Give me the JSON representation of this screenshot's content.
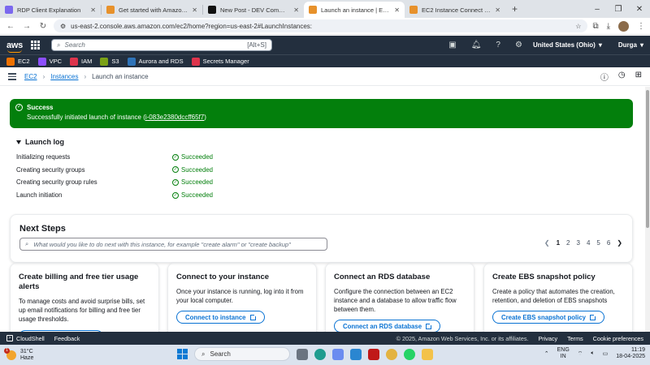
{
  "browser": {
    "tabs": [
      {
        "title": "RDP Client Explanation",
        "favicon_color": "#7b68ee",
        "active": false
      },
      {
        "title": "Get started with Amazon EC2",
        "favicon_color": "#e7912b",
        "active": false
      },
      {
        "title": "New Post - DEV Community",
        "favicon_color": "#111111",
        "active": false
      },
      {
        "title": "Launch an instance | EC2 | us-e",
        "favicon_color": "#e7912b",
        "active": true
      },
      {
        "title": "EC2 Instance Connect | us-east",
        "favicon_color": "#e7912b",
        "active": false
      }
    ],
    "url": "us-east-2.console.aws.amazon.com/ec2/home?region=us-east-2#LaunchInstances:"
  },
  "aws": {
    "logo": "aws",
    "search_placeholder": "Search",
    "search_shortcut": "[Alt+S]",
    "region": "United States (Ohio)",
    "user": "Durga",
    "favorites": [
      {
        "label": "EC2",
        "color": "#ed7100"
      },
      {
        "label": "VPC",
        "color": "#8c4fff"
      },
      {
        "label": "IAM",
        "color": "#dd344c"
      },
      {
        "label": "S3",
        "color": "#7aa116"
      },
      {
        "label": "Aurora and RDS",
        "color": "#2e73b8"
      },
      {
        "label": "Secrets Manager",
        "color": "#dd344c"
      }
    ]
  },
  "breadcrumb": {
    "ec2": "EC2",
    "instances": "Instances",
    "current": "Launch an instance"
  },
  "flash": {
    "title": "Success",
    "message_prefix": "Successfully initiated launch of instance (",
    "instance_id": "i-083e2380dccff65f7",
    "message_suffix": ")"
  },
  "launch_log": {
    "title": "Launch log",
    "rows": [
      {
        "step": "Initializing requests",
        "status": "Succeeded"
      },
      {
        "step": "Creating security groups",
        "status": "Succeeded"
      },
      {
        "step": "Creating security group rules",
        "status": "Succeeded"
      },
      {
        "step": "Launch initiation",
        "status": "Succeeded"
      }
    ]
  },
  "next_steps": {
    "title": "Next Steps",
    "search_placeholder": "What would you like to do next with this instance, for example \"create alarm\" or \"create backup\"",
    "pages": [
      "1",
      "2",
      "3",
      "4",
      "5",
      "6"
    ],
    "current_page": "1"
  },
  "cards": [
    {
      "title": "Create billing and free tier usage alerts",
      "desc": "To manage costs and avoid surprise bills, set up email notifications for billing and free tier usage thresholds.",
      "button": ""
    },
    {
      "title": "Connect to your instance",
      "desc": "Once your instance is running, log into it from your local computer.",
      "button": "Connect to instance"
    },
    {
      "title": "Connect an RDS database",
      "desc": "Configure the connection between an EC2 instance and a database to allow traffic flow between them.",
      "button": "Connect an RDS database"
    },
    {
      "title": "Create EBS snapshot policy",
      "desc": "Create a policy that automates the creation, retention, and deletion of EBS snapshots",
      "button": "Create EBS snapshot policy"
    }
  ],
  "footer": {
    "cloudshell": "CloudShell",
    "feedback": "Feedback",
    "copyright": "© 2025, Amazon Web Services, Inc. or its affiliates.",
    "privacy": "Privacy",
    "terms": "Terms",
    "cookies": "Cookie preferences"
  },
  "taskbar": {
    "temp": "31°C",
    "weather": "Haze",
    "weather_badge": "1",
    "search": "Search",
    "lang_line1": "ENG",
    "lang_line2": "IN",
    "time": "11:19",
    "date": "18-04-2025"
  }
}
